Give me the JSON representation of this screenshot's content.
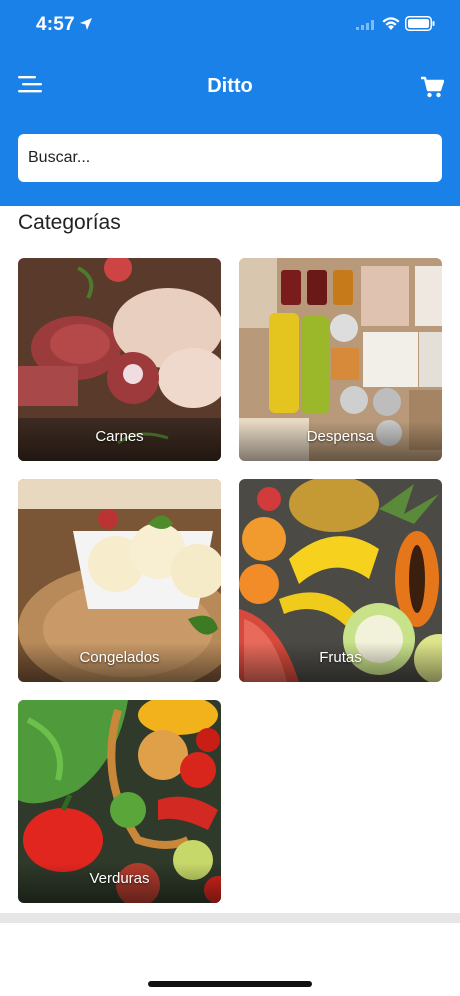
{
  "status_bar": {
    "time": "4:57"
  },
  "header": {
    "title": "Ditto"
  },
  "search": {
    "placeholder": "Buscar..."
  },
  "categories": {
    "title": "Categorías",
    "items": [
      {
        "label": "Carnes"
      },
      {
        "label": "Despensa"
      },
      {
        "label": "Congelados"
      },
      {
        "label": "Frutas"
      },
      {
        "label": "Verduras"
      }
    ]
  },
  "colors": {
    "primary": "#1a81e8",
    "background": "#ffffff",
    "text": "#222222"
  },
  "icons": {
    "menu": "menu-icon",
    "cart": "cart-icon",
    "location": "location-arrow-icon",
    "wifi": "wifi-icon",
    "battery": "battery-icon",
    "signal": "cellular-signal-icon"
  }
}
